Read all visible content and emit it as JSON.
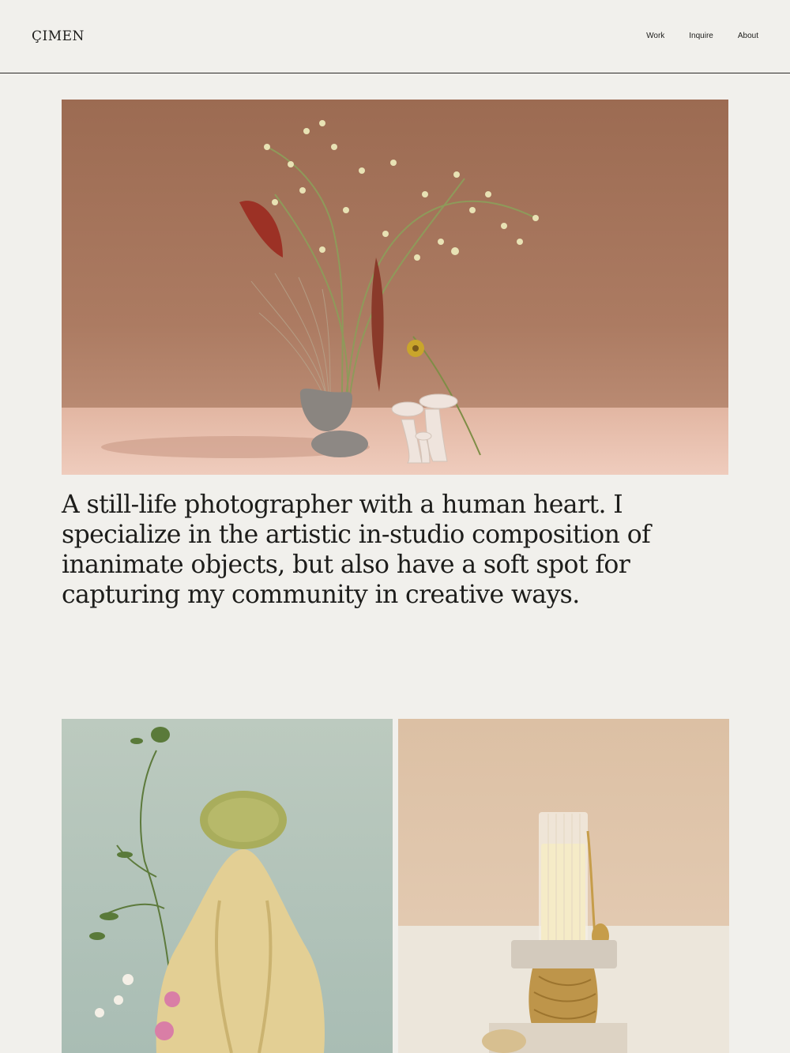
{
  "header": {
    "logo": "ÇIMEN",
    "nav": [
      {
        "label": "Work"
      },
      {
        "label": "Inquire"
      },
      {
        "label": "About"
      }
    ]
  },
  "hero": {
    "image": "still-life-flower-arrangement-photo",
    "colors": {
      "wall": "#a8765d",
      "floor": "#e8bfac"
    }
  },
  "intro": {
    "text": "A still-life photographer with a human heart. I specialize in the artistic in-studio composition of inanimate objects, but also have a soft spot for capturing my community in creative ways."
  },
  "gallery": [
    {
      "image": "prickly-pear-and-squash-still-life-photo",
      "background": "#b3c4bb"
    },
    {
      "image": "milk-glass-on-stone-and-amber-vase-photo",
      "background": "#dec5ac"
    }
  ]
}
